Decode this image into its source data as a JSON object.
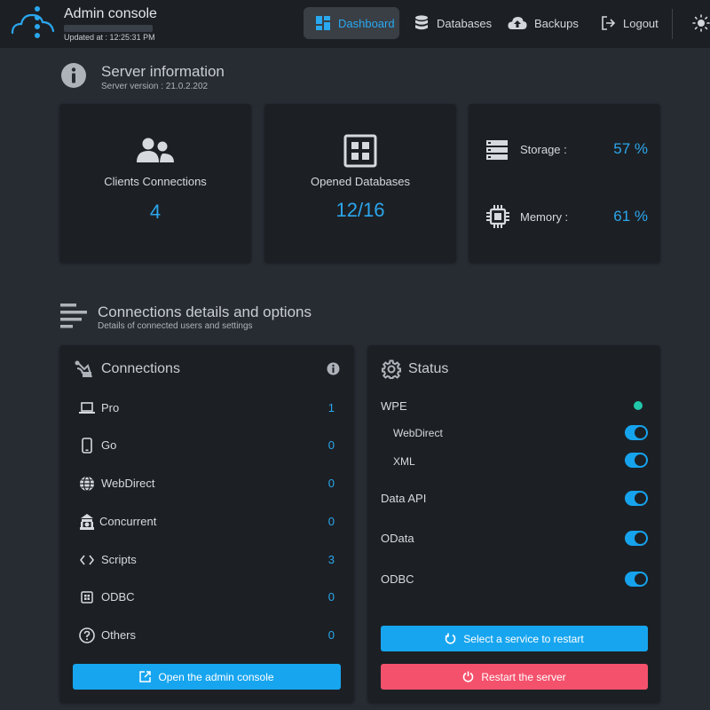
{
  "header": {
    "app_title": "Admin console",
    "updated": "Updated at : 12:25:31 PM",
    "nav": [
      {
        "label": "Dashboard",
        "icon": "dashboard-icon",
        "active": true
      },
      {
        "label": "Databases",
        "icon": "database-icon",
        "active": false
      },
      {
        "label": "Backups",
        "icon": "cloud-upload-icon",
        "active": false
      },
      {
        "label": "Logout",
        "icon": "logout-icon",
        "active": false
      }
    ]
  },
  "server_info": {
    "title": "Server information",
    "version": "Server version : 21.0.2.202"
  },
  "stats": {
    "clients": {
      "label": "Clients Connections",
      "value": "4"
    },
    "databases": {
      "label": "Opened Databases",
      "value": "12/16"
    },
    "storage": {
      "label": "Storage :",
      "value": "57 %",
      "fraction": 0.57
    },
    "memory": {
      "label": "Memory :",
      "value": "61 %",
      "fraction": 0.61
    }
  },
  "details": {
    "title": "Connections details and options",
    "subtitle": "Details of connected users and settings"
  },
  "connections": {
    "title": "Connections",
    "rows": [
      {
        "label": "Pro",
        "count": "1",
        "icon": "laptop-icon"
      },
      {
        "label": "Go",
        "count": "0",
        "icon": "mobile-icon"
      },
      {
        "label": "WebDirect",
        "count": "0",
        "icon": "globe-icon"
      },
      {
        "label": "Concurrent",
        "count": "0",
        "icon": "concurrent-icon"
      },
      {
        "label": "Scripts",
        "count": "3",
        "icon": "code-icon"
      },
      {
        "label": "ODBC",
        "count": "0",
        "icon": "odbc-icon"
      },
      {
        "label": "Others",
        "count": "0",
        "icon": "question-icon"
      }
    ],
    "open_button": "Open the admin console"
  },
  "status": {
    "title": "Status",
    "wpe": "WPE",
    "webdirect": "WebDirect",
    "xml": "XML",
    "data_api": "Data API",
    "odata": "OData",
    "odbc": "ODBC",
    "select_restart": "Select a service to restart",
    "restart_server": "Restart the server"
  },
  "colors": {
    "accent": "#2ca6ec",
    "danger": "#f4516c",
    "online": "#22c7a9",
    "card_bg": "#1c2025",
    "page_bg": "#272c33"
  }
}
